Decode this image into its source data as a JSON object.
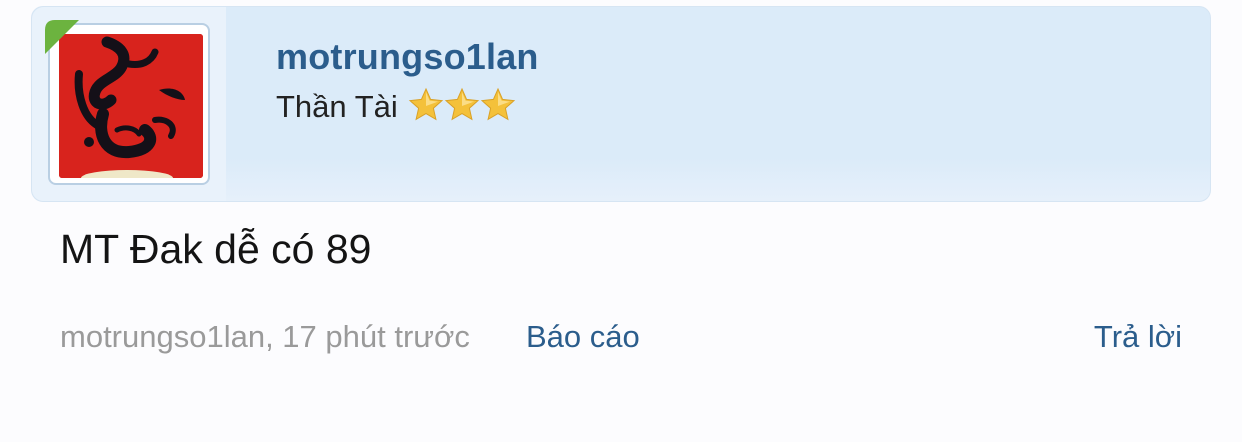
{
  "post": {
    "author": {
      "username": "motrungso1lan",
      "rank_title": "Thần Tài",
      "rank_stars": 3,
      "online": true,
      "avatar": "calligraphy-avatar"
    },
    "message": "MT Đak dễ có 89",
    "meta": {
      "byline": "motrungso1lan, 17 phút trước",
      "report_label": "Báo cáo",
      "reply_label": "Trả lời"
    }
  },
  "colors": {
    "card_background": "#dbebf9",
    "link": "#2b5d8c",
    "muted_text": "#9a9a9a",
    "online_badge": "#6cb33f",
    "star": "#f4c13a"
  }
}
